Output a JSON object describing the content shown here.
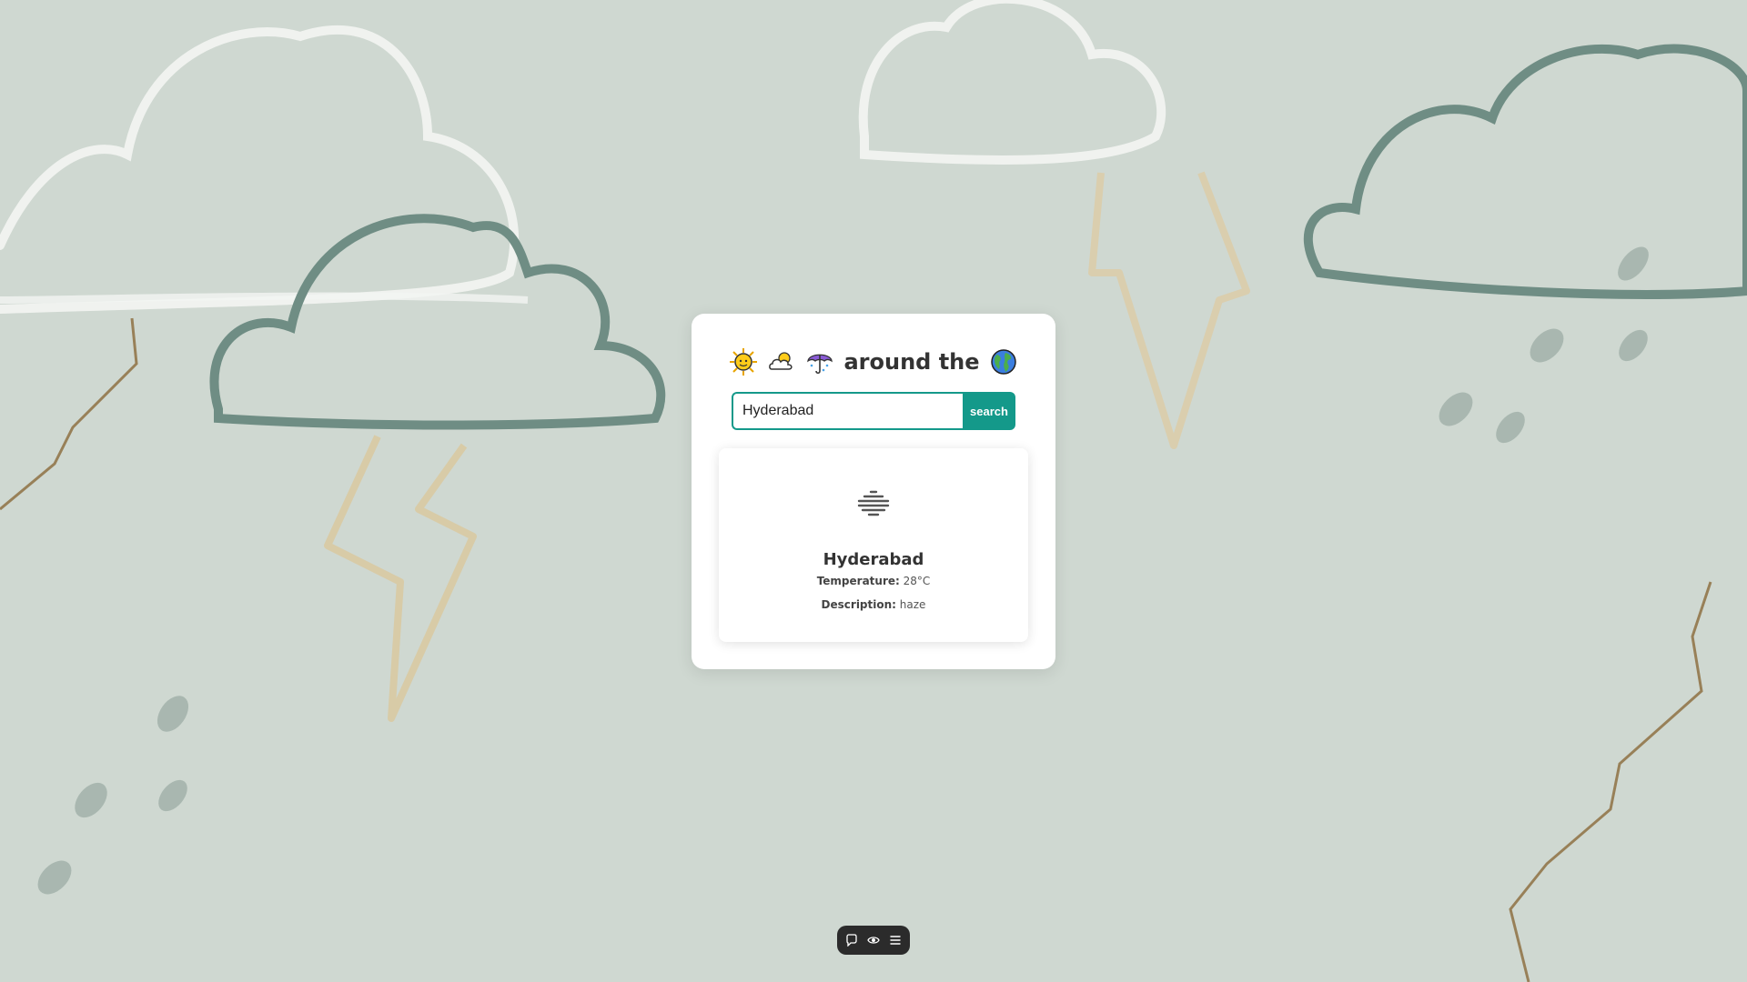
{
  "header": {
    "icons": [
      "sun-icon",
      "cloud-icon",
      "umbrella-icon",
      "globe-icon"
    ],
    "title": "around the"
  },
  "search": {
    "value": "Hyderabad",
    "button_label": "search"
  },
  "weather": {
    "icon": "haze-icon",
    "city": "Hyderabad",
    "temperature_label": "Temperature:",
    "temperature_value": "28°C",
    "description_label": "Description:",
    "description_value": "haze"
  },
  "toolbar": {
    "icons": [
      "comment-icon",
      "eye-icon",
      "menu-icon"
    ]
  },
  "colors": {
    "accent": "#14998a",
    "background": "#cfd8d1",
    "card": "#ffffff"
  }
}
